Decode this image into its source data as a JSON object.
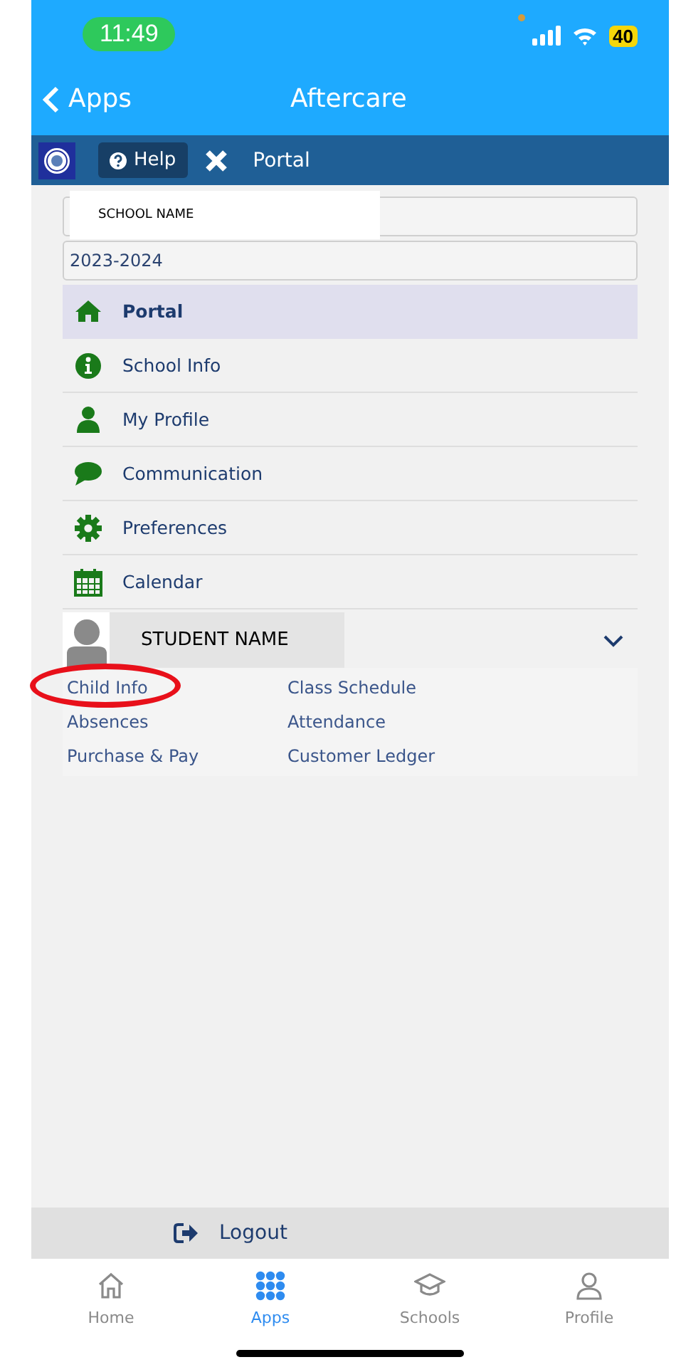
{
  "status_bar": {
    "time": "11:49",
    "battery": "40"
  },
  "nav": {
    "back": "Apps",
    "title": "Aftercare"
  },
  "toolbar": {
    "help": "Help",
    "page": "Portal"
  },
  "school": {
    "value": "SCHOOL NAME"
  },
  "year": {
    "value": "2023-2024"
  },
  "menu": [
    {
      "label": "Portal",
      "kind": "home",
      "selected": true
    },
    {
      "label": "School Info",
      "kind": "info",
      "selected": false
    },
    {
      "label": "My Profile",
      "kind": "person",
      "selected": false
    },
    {
      "label": "Communication",
      "kind": "chat",
      "selected": false
    },
    {
      "label": "Preferences",
      "kind": "gear",
      "selected": false
    },
    {
      "label": "Calendar",
      "kind": "calendar",
      "selected": false
    }
  ],
  "student": {
    "name": "STUDENT NAME",
    "expanded": true
  },
  "student_links": [
    {
      "label": "Child Info",
      "circled": true
    },
    {
      "label": "Class Schedule",
      "circled": false
    },
    {
      "label": "Absences",
      "circled": false
    },
    {
      "label": "Attendance",
      "circled": false
    },
    {
      "label": "Purchase & Pay",
      "circled": false
    },
    {
      "label": "Customer Ledger",
      "circled": false
    }
  ],
  "logout": "Logout",
  "tabs": [
    {
      "label": "Home",
      "kind": "home",
      "selected": false
    },
    {
      "label": "Apps",
      "kind": "grid",
      "selected": true
    },
    {
      "label": "Schools",
      "kind": "cap",
      "selected": false
    },
    {
      "label": "Profile",
      "kind": "person",
      "selected": false
    }
  ]
}
